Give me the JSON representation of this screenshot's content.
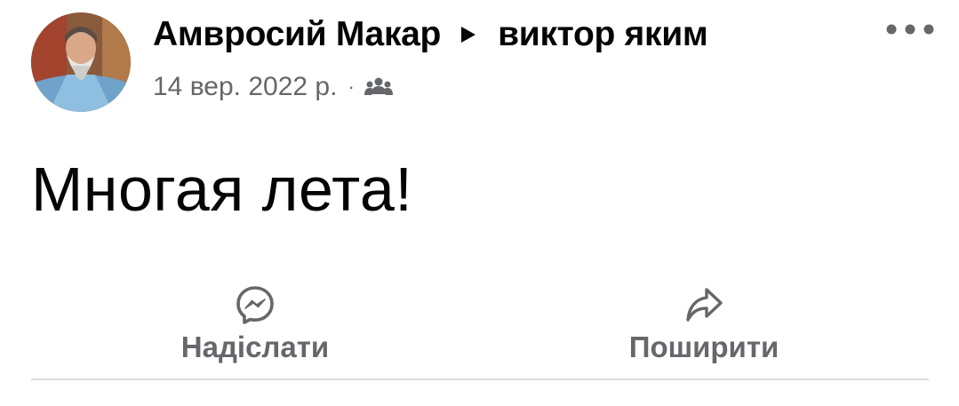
{
  "post": {
    "author": "Амвросий Макар",
    "recipient": "виктор яким",
    "timestamp": "14 вер. 2022 р.",
    "separator": "·",
    "audience_icon": "friends-icon",
    "more_icon": "more-options-icon",
    "text": "Многая лета!"
  },
  "actions": {
    "send": {
      "label": "Надіслати",
      "icon": "messenger-icon"
    },
    "share": {
      "label": "Поширити",
      "icon": "share-arrow-icon"
    }
  },
  "colors": {
    "primary_text": "#050505",
    "secondary_text": "#65676b",
    "divider": "#dcdde1",
    "background": "#ffffff"
  }
}
